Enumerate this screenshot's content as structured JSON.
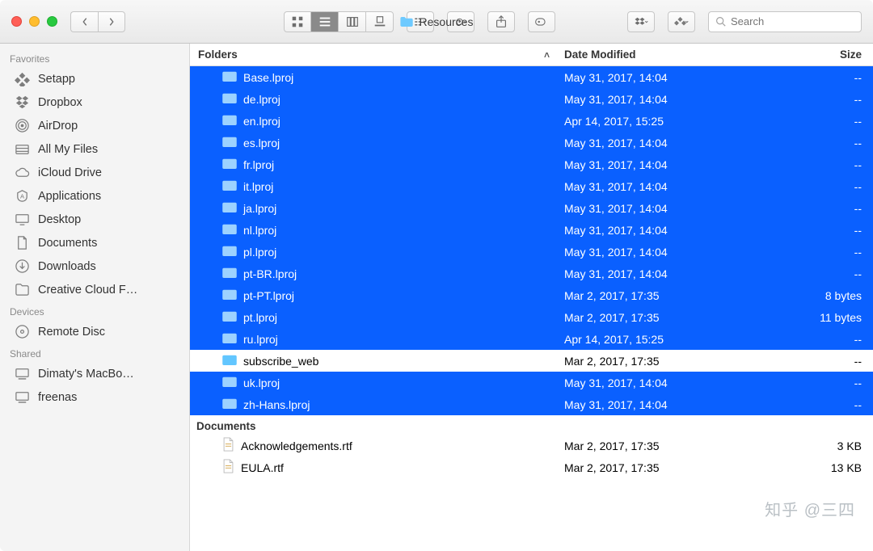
{
  "window": {
    "title": "Resources"
  },
  "toolbar": {
    "search_placeholder": "Search"
  },
  "sidebar": {
    "sections": [
      {
        "label": "Favorites",
        "items": [
          {
            "icon": "setapp",
            "label": "Setapp"
          },
          {
            "icon": "dropbox",
            "label": "Dropbox"
          },
          {
            "icon": "airdrop",
            "label": "AirDrop"
          },
          {
            "icon": "allfiles",
            "label": "All My Files"
          },
          {
            "icon": "icloud",
            "label": "iCloud Drive"
          },
          {
            "icon": "applications",
            "label": "Applications"
          },
          {
            "icon": "desktop",
            "label": "Desktop"
          },
          {
            "icon": "documents",
            "label": "Documents"
          },
          {
            "icon": "downloads",
            "label": "Downloads"
          },
          {
            "icon": "folder",
            "label": "Creative Cloud F…"
          }
        ]
      },
      {
        "label": "Devices",
        "items": [
          {
            "icon": "disc",
            "label": "Remote Disc"
          }
        ]
      },
      {
        "label": "Shared",
        "items": [
          {
            "icon": "computer",
            "label": "Dimaty's MacBo…"
          },
          {
            "icon": "computer",
            "label": "freenas"
          }
        ]
      }
    ]
  },
  "columns": {
    "name": "Folders",
    "date": "Date Modified",
    "size": "Size"
  },
  "groups": [
    {
      "label": "Folders",
      "rows": [
        {
          "name": "Base.lproj",
          "date": "May 31, 2017, 14:04",
          "size": "--",
          "selected": true,
          "kind": "folder"
        },
        {
          "name": "de.lproj",
          "date": "May 31, 2017, 14:04",
          "size": "--",
          "selected": true,
          "kind": "folder"
        },
        {
          "name": "en.lproj",
          "date": "Apr 14, 2017, 15:25",
          "size": "--",
          "selected": true,
          "kind": "folder"
        },
        {
          "name": "es.lproj",
          "date": "May 31, 2017, 14:04",
          "size": "--",
          "selected": true,
          "kind": "folder"
        },
        {
          "name": "fr.lproj",
          "date": "May 31, 2017, 14:04",
          "size": "--",
          "selected": true,
          "kind": "folder"
        },
        {
          "name": "it.lproj",
          "date": "May 31, 2017, 14:04",
          "size": "--",
          "selected": true,
          "kind": "folder"
        },
        {
          "name": "ja.lproj",
          "date": "May 31, 2017, 14:04",
          "size": "--",
          "selected": true,
          "kind": "folder"
        },
        {
          "name": "nl.lproj",
          "date": "May 31, 2017, 14:04",
          "size": "--",
          "selected": true,
          "kind": "folder"
        },
        {
          "name": "pl.lproj",
          "date": "May 31, 2017, 14:04",
          "size": "--",
          "selected": true,
          "kind": "folder"
        },
        {
          "name": "pt-BR.lproj",
          "date": "May 31, 2017, 14:04",
          "size": "--",
          "selected": true,
          "kind": "folder"
        },
        {
          "name": "pt-PT.lproj",
          "date": "Mar 2, 2017, 17:35",
          "size": "8 bytes",
          "selected": true,
          "kind": "folder"
        },
        {
          "name": "pt.lproj",
          "date": "Mar 2, 2017, 17:35",
          "size": "11 bytes",
          "selected": true,
          "kind": "folder"
        },
        {
          "name": "ru.lproj",
          "date": "Apr 14, 2017, 15:25",
          "size": "--",
          "selected": true,
          "kind": "folder"
        },
        {
          "name": "subscribe_web",
          "date": "Mar 2, 2017, 17:35",
          "size": "--",
          "selected": false,
          "kind": "folder"
        },
        {
          "name": "uk.lproj",
          "date": "May 31, 2017, 14:04",
          "size": "--",
          "selected": true,
          "kind": "folder"
        },
        {
          "name": "zh-Hans.lproj",
          "date": "May 31, 2017, 14:04",
          "size": "--",
          "selected": true,
          "kind": "folder"
        }
      ]
    },
    {
      "label": "Documents",
      "rows": [
        {
          "name": "Acknowledgements.rtf",
          "date": "Mar 2, 2017, 17:35",
          "size": "3 KB",
          "selected": false,
          "kind": "document"
        },
        {
          "name": "EULA.rtf",
          "date": "Mar 2, 2017, 17:35",
          "size": "13 KB",
          "selected": false,
          "kind": "document"
        }
      ]
    }
  ],
  "watermark": "知乎 @三四"
}
